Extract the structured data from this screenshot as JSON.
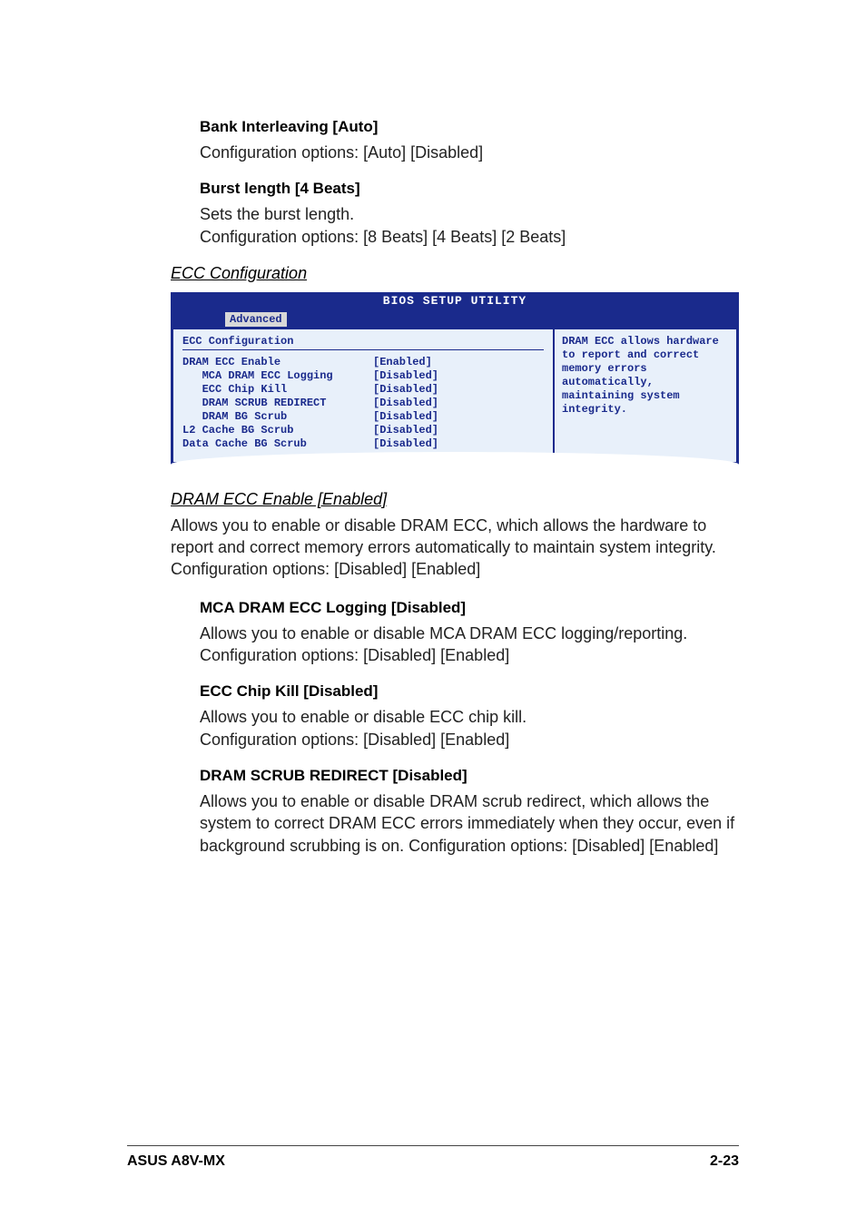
{
  "options": {
    "bank_interleaving": {
      "title": "Bank Interleaving [Auto]",
      "body": "Configuration options: [Auto] [Disabled]"
    },
    "burst_length": {
      "title": "Burst length [4 Beats]",
      "body_line1": "Sets the burst length.",
      "body_line2": "Configuration options: [8 Beats] [4 Beats] [2 Beats]"
    }
  },
  "ecc_heading": "ECC Configuration",
  "bios": {
    "title": "BIOS SETUP UTILITY",
    "tab": "Advanced",
    "section": "ECC Configuration",
    "rows": [
      {
        "label": "DRAM ECC Enable",
        "value": "[Enabled]"
      },
      {
        "label": "   MCA DRAM ECC Logging",
        "value": "[Disabled]"
      },
      {
        "label": "   ECC Chip Kill",
        "value": "[Disabled]"
      },
      {
        "label": "   DRAM SCRUB REDIRECT",
        "value": "[Disabled]"
      },
      {
        "label": "   DRAM BG Scrub",
        "value": "[Disabled]"
      },
      {
        "label": "L2 Cache BG Scrub",
        "value": "[Disabled]"
      },
      {
        "label": "Data Cache BG Scrub",
        "value": "[Disabled]"
      }
    ],
    "help": "DRAM ECC allows hardware to report and correct memory errors automatically, maintaining system integrity."
  },
  "dram_ecc_enable": {
    "title": "DRAM ECC Enable [Enabled]",
    "body": "Allows you to enable or disable DRAM ECC, which allows the hardware to report and correct memory errors automatically to maintain system integrity. Configuration options: [Disabled] [Enabled]"
  },
  "mca_logging": {
    "title": "MCA DRAM ECC Logging [Disabled]",
    "body_line1": "Allows you to enable or disable MCA DRAM ECC logging/reporting.",
    "body_line2": "Configuration options: [Disabled] [Enabled]"
  },
  "chip_kill": {
    "title": "ECC Chip Kill  [Disabled]",
    "body_line1": "Allows you to enable or disable ECC chip kill.",
    "body_line2": "Configuration options: [Disabled] [Enabled]"
  },
  "scrub_redirect": {
    "title": "DRAM SCRUB REDIRECT [Disabled]",
    "body": "Allows you to enable or disable DRAM scrub redirect, which allows the system to correct DRAM ECC errors immediately when they occur, even if background scrubbing is on. Configuration options: [Disabled] [Enabled]"
  },
  "footer": {
    "left": "ASUS A8V-MX",
    "right": "2-23"
  }
}
